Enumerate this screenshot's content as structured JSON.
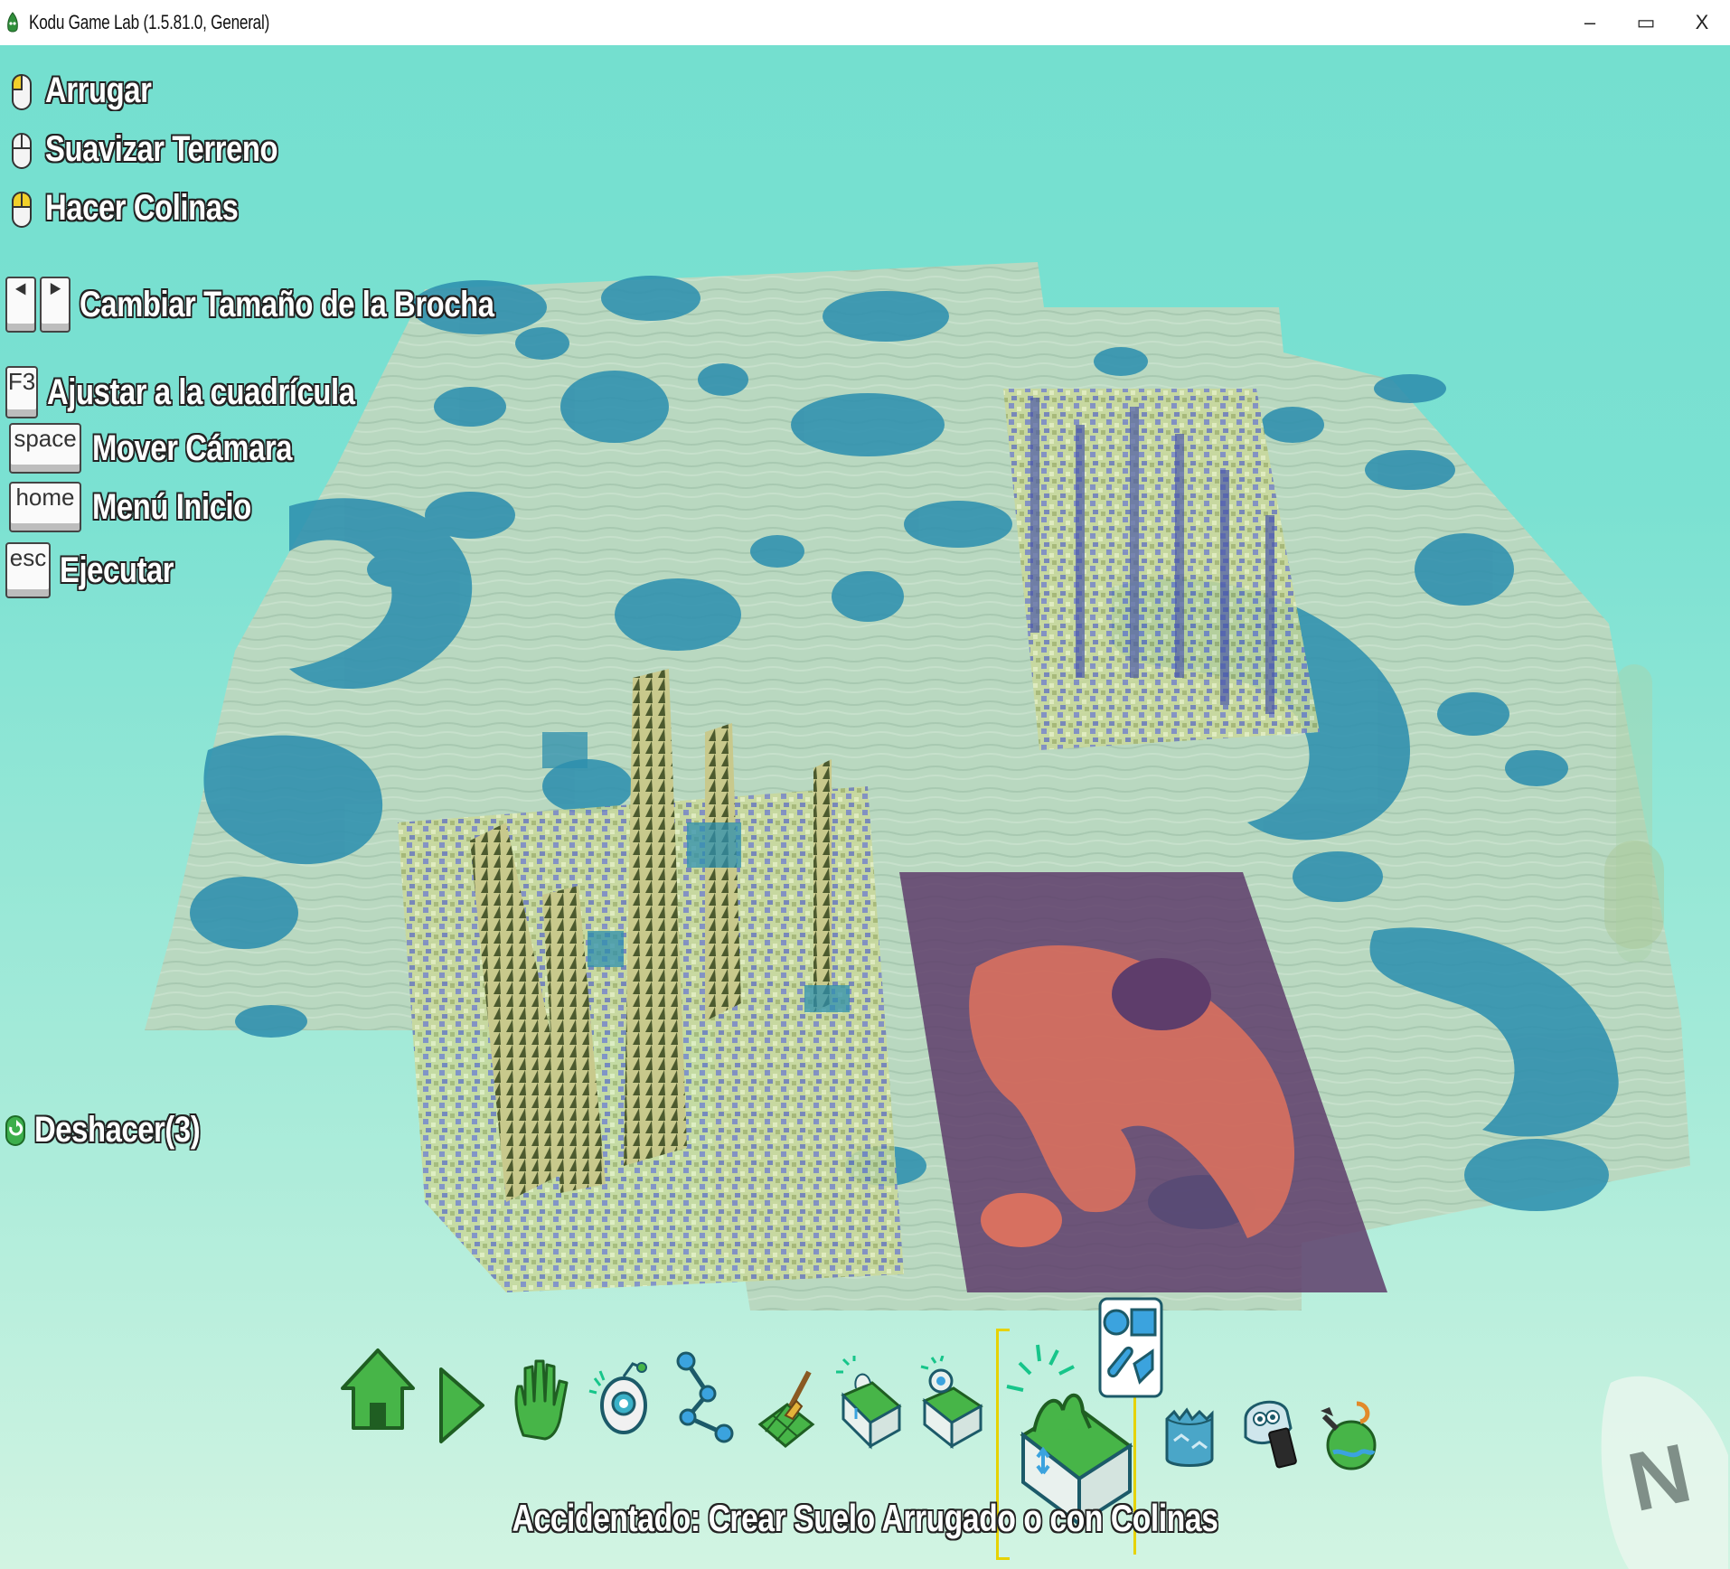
{
  "window": {
    "title": "Kodu Game Lab (1.5.81.0, General)",
    "controls": {
      "minimize": "–",
      "restore": "▭",
      "close": "X"
    }
  },
  "hud": {
    "mouse_actions": [
      {
        "label": "Arrugar",
        "icon": "mouse-left-icon"
      },
      {
        "label": "Suavizar Terreno",
        "icon": "mouse-right-icon"
      },
      {
        "label": "Hacer Colinas",
        "icon": "mouse-both-icon"
      }
    ],
    "brush_size": {
      "left_key": "⯇",
      "right_key": "⯈",
      "label": "Cambiar Tamaño de la Brocha"
    },
    "snap": {
      "key": "F3",
      "label": "Ajustar a la cuadrícula"
    },
    "camera": {
      "key": "space",
      "label": "Mover Cámara"
    },
    "home_menu": {
      "key": "home",
      "label": "Menú Inicio"
    },
    "run": {
      "key": "esc",
      "label": "Ejecutar"
    },
    "undo": {
      "label": "Deshacer(3)"
    }
  },
  "toolbar": {
    "tools": [
      {
        "name": "home-tool",
        "icon": "home-icon"
      },
      {
        "name": "play-tool",
        "icon": "play-icon"
      },
      {
        "name": "hand-tool",
        "icon": "hand-icon"
      },
      {
        "name": "object-tool",
        "icon": "kodu-object-icon"
      },
      {
        "name": "path-tool",
        "icon": "path-icon"
      },
      {
        "name": "paint-tool",
        "icon": "terrain-paint-icon"
      },
      {
        "name": "raise-lower-tool",
        "icon": "terrain-up-down-icon"
      },
      {
        "name": "smooth-tool",
        "icon": "terrain-smooth-icon"
      },
      {
        "name": "rough-tool",
        "icon": "terrain-rough-icon",
        "selected": true
      },
      {
        "name": "water-tool",
        "icon": "water-icon"
      },
      {
        "name": "delete-tool",
        "icon": "eraser-icon"
      },
      {
        "name": "world-settings-tool",
        "icon": "world-settings-icon"
      }
    ],
    "brush_shape_icon": "brush-shapes-icon",
    "status": "Accidentado: Crear Suelo Arrugado o con Colinas",
    "accent_color": "#e6d200"
  },
  "compass": {
    "letter": "N"
  }
}
